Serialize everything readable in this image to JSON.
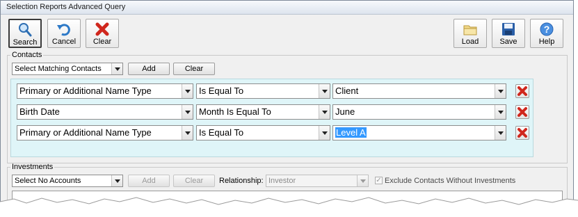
{
  "window": {
    "title": "Selection Reports Advanced Query"
  },
  "toolbar": {
    "search_label": "Search",
    "cancel_label": "Cancel",
    "clear_label": "Clear",
    "load_label": "Load",
    "save_label": "Save",
    "help_label": "Help"
  },
  "contacts": {
    "legend": "Contacts",
    "match_value": "Select Matching Contacts",
    "add_label": "Add",
    "clear_label": "Clear",
    "criteria": [
      {
        "field": "Primary or Additional Name Type",
        "operator": "Is Equal To",
        "value": "Client"
      },
      {
        "field": "Birth Date",
        "operator": "Month Is Equal To",
        "value": "June"
      },
      {
        "field": "Primary or Additional Name Type",
        "operator": "Is Equal To",
        "value": "Level A"
      }
    ]
  },
  "investments": {
    "legend": "Investments",
    "accounts_value": "Select No Accounts",
    "add_label": "Add",
    "clear_label": "Clear",
    "relationship_label": "Relationship:",
    "relationship_value": "Investor",
    "exclude_label": "Exclude Contacts Without Investments",
    "exclude_checked": true
  },
  "colors": {
    "criteria_panel": "#dff5f8",
    "selection_highlight": "#3399ff",
    "delete_icon": "#d0271d"
  }
}
